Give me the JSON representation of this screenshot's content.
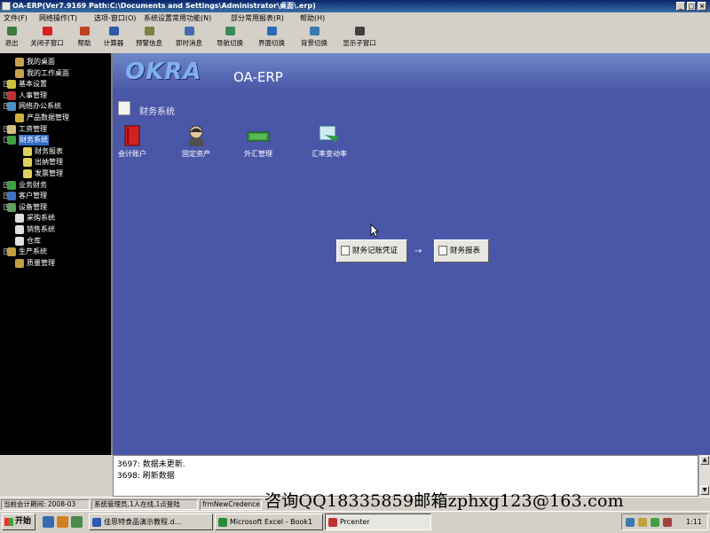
{
  "window": {
    "title": "OA-ERP(Ver7.9169 Path:C:\\Documents and Settings\\Administrator\\桌面\\.erp)"
  },
  "menubar": [
    "文件(F)",
    "网络操作(T)",
    "选项-窗口(O)",
    "系统设置常用功能(N)",
    "部分常用报表(R)",
    "帮助(H)"
  ],
  "toolbar": [
    {
      "label": "退出",
      "icon": "exit-icon",
      "color": "#3a7d3a"
    },
    {
      "label": "关闭子窗口",
      "icon": "close-child-icon",
      "color": "#d62020"
    },
    {
      "label": "帮助",
      "icon": "help-icon",
      "color": "#c04020"
    },
    {
      "label": "计算器",
      "icon": "calculator-icon",
      "color": "#2a5aa8"
    },
    {
      "label": "预警信息",
      "icon": "alert-icon",
      "color": "#808040"
    },
    {
      "label": "即时消息",
      "icon": "message-icon",
      "color": "#4a6ab0"
    },
    {
      "label": "导航切换",
      "icon": "nav-switch-icon",
      "color": "#3a8a5a"
    },
    {
      "label": "界面切换",
      "icon": "ui-switch-icon",
      "color": "#2a6ab8"
    },
    {
      "label": "背景切换",
      "icon": "bg-switch-icon",
      "color": "#3a7ab0"
    },
    {
      "label": "显示子窗口",
      "icon": "show-child-icon",
      "color": "#404040"
    }
  ],
  "tree": [
    {
      "label": "我的桌面",
      "level": 1,
      "expander": "",
      "icon": "desktop-icon",
      "color": "#c8a050"
    },
    {
      "label": "我的工作桌面",
      "level": 1,
      "expander": "",
      "icon": "work-desktop-icon",
      "color": "#c8a050"
    },
    {
      "label": "基本设置",
      "level": 0,
      "expander": "+",
      "icon": "settings-icon",
      "color": "#d0c040"
    },
    {
      "label": "人事管理",
      "level": 0,
      "expander": "+",
      "icon": "hr-icon",
      "color": "#c03030"
    },
    {
      "label": "网络办公系统",
      "level": 0,
      "expander": "+",
      "icon": "office-icon",
      "color": "#4a90c8"
    },
    {
      "label": "产品数据管理",
      "level": 1,
      "expander": "",
      "icon": "product-icon",
      "color": "#d0b040"
    },
    {
      "label": "工资管理",
      "level": 0,
      "expander": "+",
      "icon": "salary-icon",
      "color": "#d0c080"
    },
    {
      "label": "财务系统",
      "level": 0,
      "expander": "-",
      "icon": "finance-icon",
      "color": "#40a040",
      "selected": true
    },
    {
      "label": "财务报表",
      "level": 2,
      "expander": "",
      "icon": "report-icon",
      "color": "#e0d060"
    },
    {
      "label": "出纳管理",
      "level": 2,
      "expander": "",
      "icon": "cashier-icon",
      "color": "#e0d060"
    },
    {
      "label": "发票管理",
      "level": 2,
      "expander": "",
      "icon": "invoice-icon",
      "color": "#e0d060"
    },
    {
      "label": "业务财务",
      "level": 0,
      "expander": "+",
      "icon": "biz-finance-icon",
      "color": "#40a040"
    },
    {
      "label": "客户管理",
      "level": 0,
      "expander": "+",
      "icon": "customer-icon",
      "color": "#4070c0"
    },
    {
      "label": "设备管理",
      "level": 0,
      "expander": "+",
      "icon": "equipment-icon",
      "color": "#60a060"
    },
    {
      "label": "采购系统",
      "level": 1,
      "expander": "",
      "icon": "purchase-icon",
      "color": "#e0e0e0"
    },
    {
      "label": "销售系统",
      "level": 1,
      "expander": "",
      "icon": "sales-icon",
      "color": "#e0e0e0"
    },
    {
      "label": "仓库",
      "level": 1,
      "expander": "",
      "icon": "warehouse-icon",
      "color": "#e0e0e0"
    },
    {
      "label": "生产系统",
      "level": 0,
      "expander": "+",
      "icon": "production-icon",
      "color": "#c0a040"
    },
    {
      "label": "质量管理",
      "level": 1,
      "expander": "",
      "icon": "quality-icon",
      "color": "#c0a040"
    }
  ],
  "main": {
    "logo": "OKRA",
    "logo_sub": "OA-ERP",
    "section_title": "财务系统",
    "modules": [
      {
        "label": "会计账户",
        "icon": "ledger-book-icon",
        "color": "#d02020"
      },
      {
        "label": "固定资产",
        "icon": "fixed-assets-icon",
        "color": "#404040"
      },
      {
        "label": "外汇管理",
        "icon": "forex-icon",
        "color": "#3a9a3a"
      },
      {
        "label": "汇率变动率",
        "icon": "exchange-rate-icon",
        "color": "#2a8a4a"
      }
    ],
    "flow": {
      "step1": "财务记账凭证",
      "step2": "财务报表",
      "arrow": "→"
    }
  },
  "log": {
    "lines": [
      "3697: 数据未更新.",
      "3698: 刷新数据"
    ]
  },
  "statusbar": {
    "period": "当前会计期间: 2008-03",
    "admin": "系统管理员,1人在线,1点登陆",
    "form": "frmNewCredence"
  },
  "watermark": "咨询QQ18335859邮箱zphxg123@163.com",
  "taskbar": {
    "start": "开始",
    "tasks": [
      {
        "label": "佳思特食品演示教程.d...",
        "color": "#2a5ab8",
        "active": false
      },
      {
        "label": "Microsoft Excel - Book1",
        "color": "#2a8a3a",
        "active": false
      },
      {
        "label": "Prcenter",
        "color": "#c03030",
        "active": true
      }
    ],
    "clock": "1:11"
  }
}
